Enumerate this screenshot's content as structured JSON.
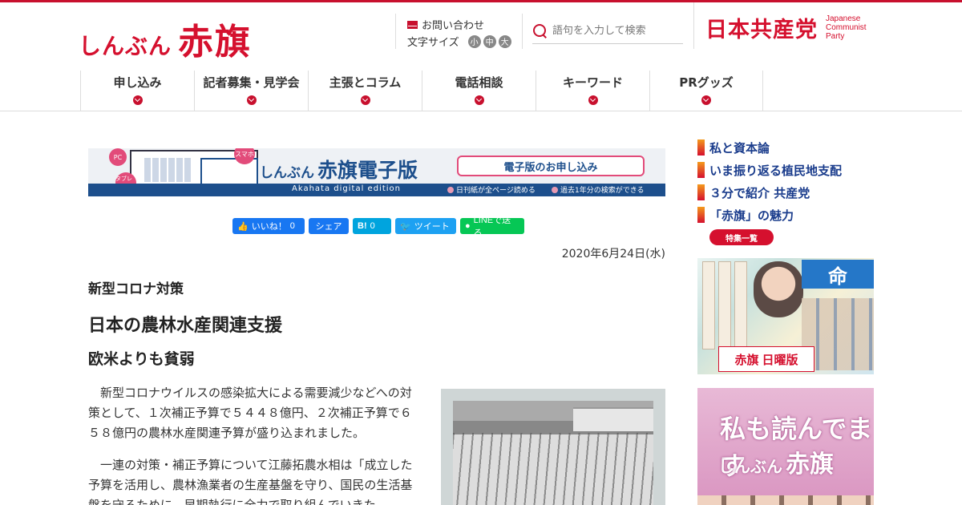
{
  "header": {
    "logo_small": "しんぶん",
    "logo_big": "赤旗",
    "contact_label": "お問い合わせ",
    "font_size_label": "文字サイズ",
    "font_sizes": [
      "小",
      "中",
      "大"
    ],
    "search_placeholder": "語句を入力して検索",
    "party_name": "日本共産党",
    "party_en_1": "Japanese",
    "party_en_2": "Communist",
    "party_en_3": "Party"
  },
  "nav": {
    "items": [
      {
        "label": "申し込み"
      },
      {
        "label": "記者募集・見学会"
      },
      {
        "label": "主張とコラム"
      },
      {
        "label": "電話相談"
      },
      {
        "label": "キーワード"
      },
      {
        "label": "PRグッズ"
      }
    ]
  },
  "banner": {
    "badge_pc": "PC",
    "badge_tablet": "タブレット",
    "badge_smartphone": "スマホ",
    "title_small": "しんぶん",
    "title_big": "赤旗電子版",
    "subtitle_en": "Akahata digital edition",
    "apply_label": "電子版のお申し込み",
    "note_1": "日刊紙が全ページ読める",
    "note_2": "過去1年分の検索ができる"
  },
  "share": {
    "like_label": "いいね！",
    "like_count": "0",
    "fb_share_label": "シェア",
    "hatena_count": "0",
    "tweet_label": "ツイート",
    "line_label": "LINEで送る"
  },
  "article": {
    "date": "2020年6月24日(水)",
    "kicker": "新型コロナ対策",
    "headline": "日本の農林水産関連支援",
    "subhead": "欧米よりも貧弱",
    "paragraphs": [
      "新型コロナウイルスの感染拡大による需要減少などへの対策として、１次補正予算で５４４８億円、２次補正予算で６５８億円の農林水産関連予算が盛り込まれました。",
      "一連の対策・補正予算について江藤拓農水相は「成立した予算を活用し、農林漁業者の生産基盤を守り、国民の生活基盤を守るために、早期執行に全力で取り組んでいきた"
    ]
  },
  "sidebar": {
    "links": [
      {
        "label": "私と資本論"
      },
      {
        "label": "いま振り返る植民地支配"
      },
      {
        "label": "３分で紹介 共産党"
      },
      {
        "label": "「赤旗」の魅力"
      }
    ],
    "features_label": "特集一覧",
    "ad1_title": "命",
    "ad1_sub": "日曜版",
    "ad1_brand": "赤旗",
    "ad2_line1": "私も読んでます",
    "ad2_small": "しんぶん",
    "ad2_big": "赤旗"
  },
  "colors": {
    "brand_red": "#d5102e",
    "link_blue": "#1a3c8c",
    "banner_blue": "#1d4f8c"
  }
}
